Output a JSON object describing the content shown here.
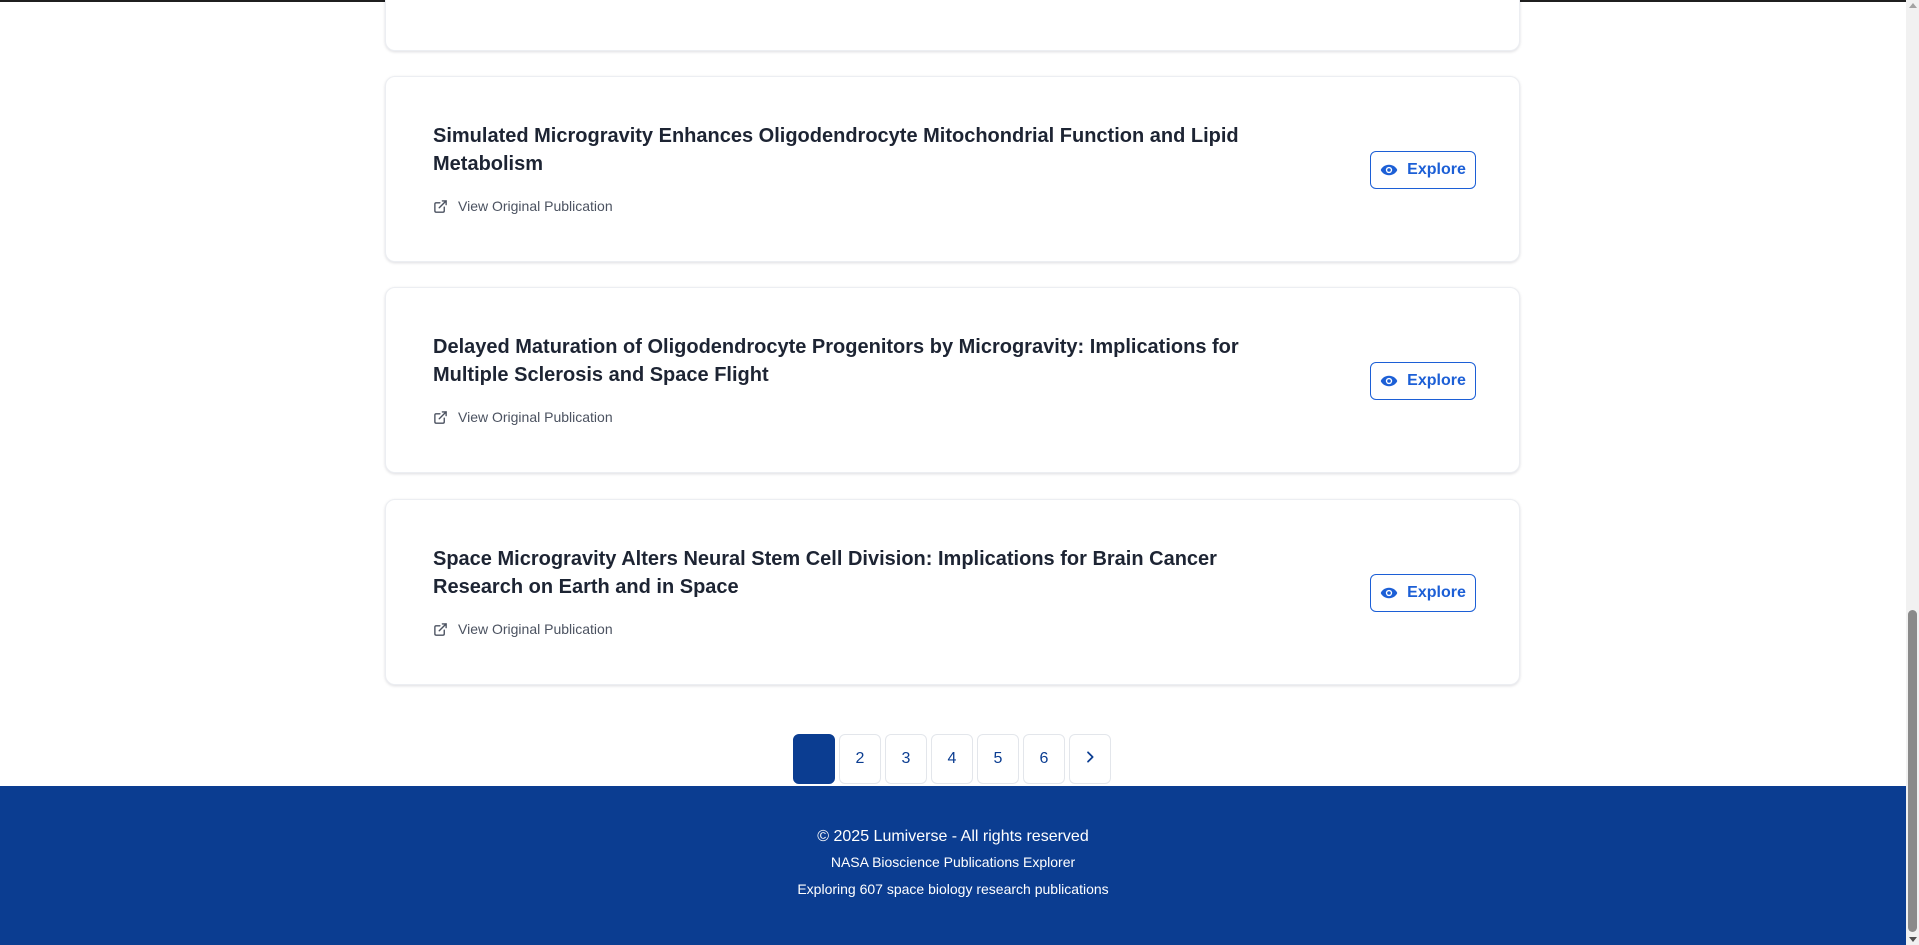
{
  "publications": [
    {
      "title": "Simulated Microgravity Enhances Oligodendrocyte Mitochondrial Function and Lipid Metabolism",
      "link_label": "View Original Publication",
      "action_label": "Explore"
    },
    {
      "title": "Delayed Maturation of Oligodendrocyte Progenitors by Microgravity: Implications for Multiple Sclerosis and Space Flight",
      "link_label": "View Original Publication",
      "action_label": "Explore"
    },
    {
      "title": "Space Microgravity Alters Neural Stem Cell Division: Implications for Brain Cancer Research on Earth and in Space",
      "link_label": "View Original Publication",
      "action_label": "Explore"
    }
  ],
  "icons": {
    "external_link": "external-link-icon",
    "explore": "eye-icon",
    "next_page": "chevron-right-icon"
  },
  "pagination": {
    "current_page": 1,
    "pages": [
      "",
      "2",
      "3",
      "4",
      "5",
      "6"
    ]
  },
  "footer": {
    "copyright": "© 2025 Lumiverse - All rights reserved",
    "subtitle": "NASA Bioscience Publications Explorer",
    "tagline": "Exploring 607 space biology research publications"
  },
  "colors": {
    "brand": "#0b3d91",
    "accent": "#1c5fd6",
    "title_text": "#1d2433",
    "muted_text": "#4b5260"
  }
}
